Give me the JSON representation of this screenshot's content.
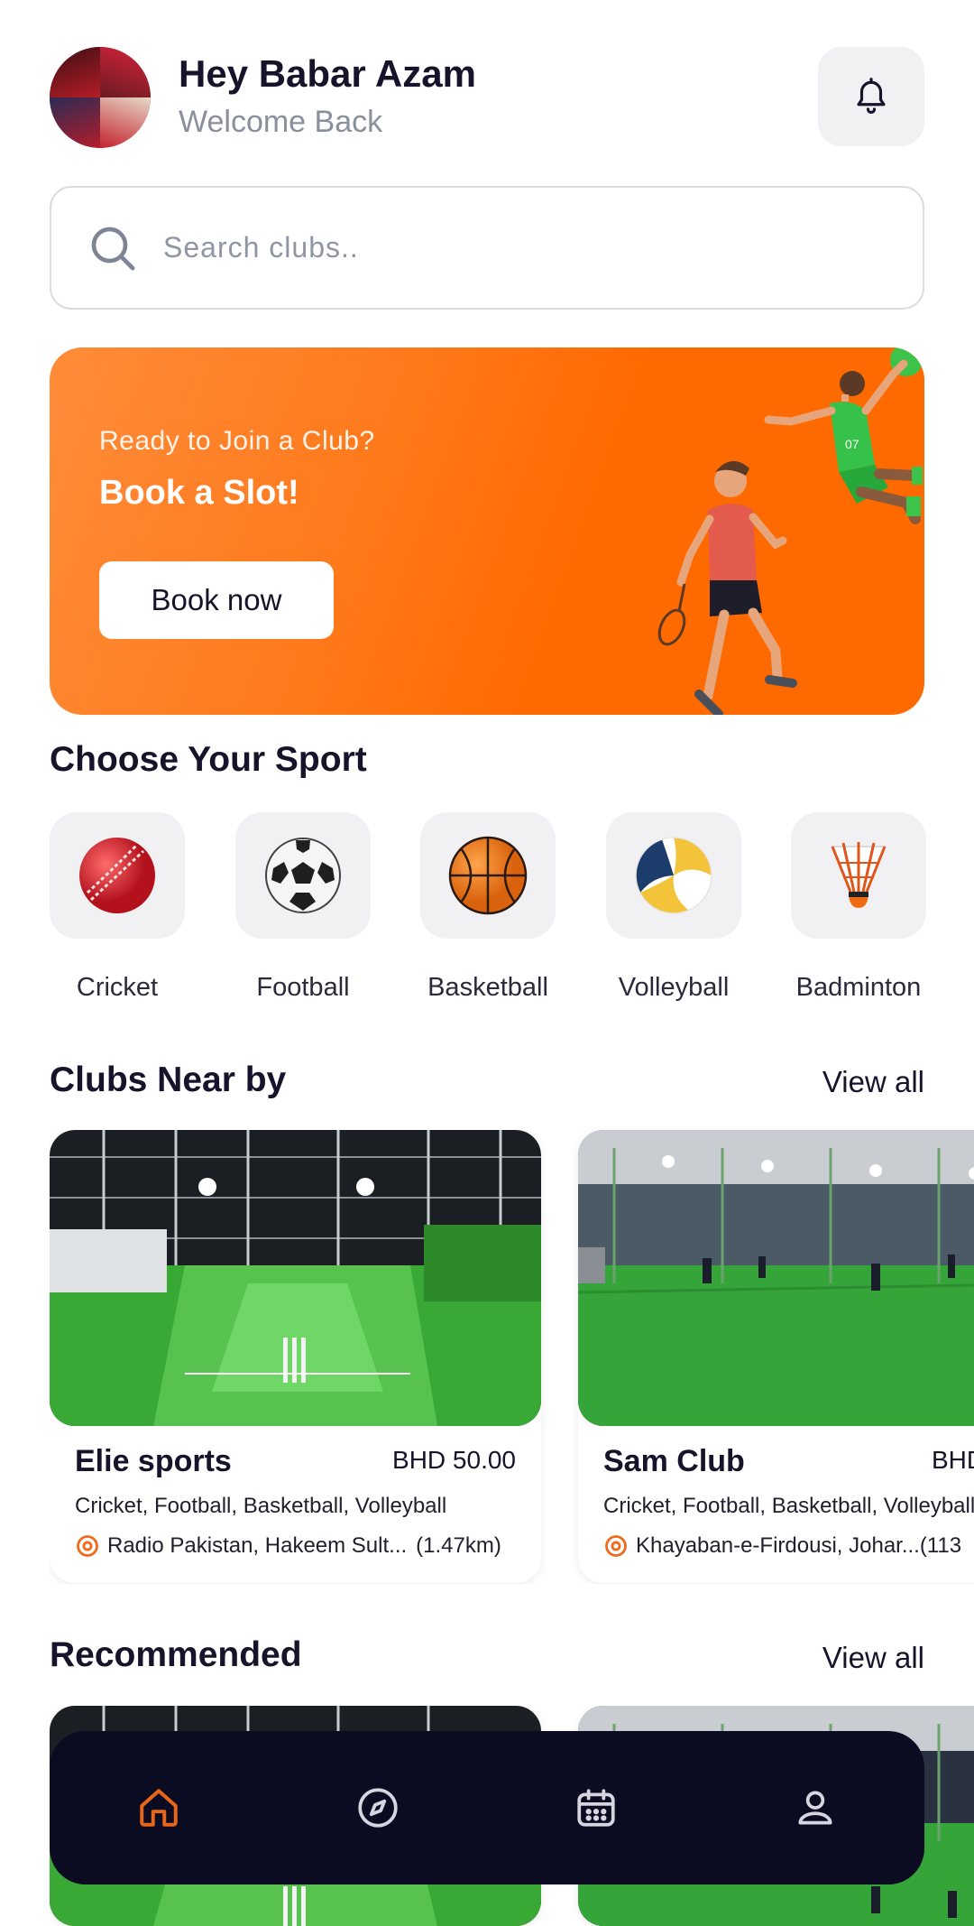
{
  "header": {
    "greeting": "Hey Babar Azam",
    "subtitle": "Welcome Back",
    "avatar_icon": "avatar-photo",
    "bell_icon": "bell-icon"
  },
  "search": {
    "placeholder": "Search clubs..",
    "icon": "search-icon"
  },
  "banner": {
    "pretitle": "Ready to Join a Club?",
    "title": "Book a Slot!",
    "button_label": "Book now",
    "colors": {
      "start": "#ff8c3a",
      "end": "#ff6a00"
    }
  },
  "sports_section": {
    "title": "Choose Your Sport",
    "items": [
      {
        "label": "Cricket",
        "icon": "cricket-ball-icon"
      },
      {
        "label": "Football",
        "icon": "football-icon"
      },
      {
        "label": "Basketball",
        "icon": "basketball-icon"
      },
      {
        "label": "Volleyball",
        "icon": "volleyball-icon"
      },
      {
        "label": "Badminton",
        "icon": "shuttlecock-icon"
      }
    ]
  },
  "clubs_section": {
    "title": "Clubs Near by",
    "view_all": "View all",
    "items": [
      {
        "name": "Elie sports",
        "price": "BHD 50.00",
        "sports": "Cricket, Football, Basketball, Volleyball",
        "location": "Radio Pakistan, Hakeem Sult...",
        "distance": "(1.47km)"
      },
      {
        "name": "Sam Club",
        "price": "BHD",
        "sports": "Cricket, Football, Basketball, Volleyball",
        "location": "Khayaban-e-Firdousi, Johar...",
        "distance": "(113"
      }
    ]
  },
  "recommended_section": {
    "title": "Recommended",
    "view_all": "View all"
  },
  "navbar": {
    "items": [
      {
        "icon": "home-icon",
        "active": true
      },
      {
        "icon": "compass-icon",
        "active": false
      },
      {
        "icon": "calendar-icon",
        "active": false
      },
      {
        "icon": "profile-icon",
        "active": false
      }
    ],
    "active_color": "#e8661a",
    "inactive_color": "#d6d6e0"
  },
  "theme": {
    "accent": "#ff6a00",
    "dark": "#0b0b22"
  }
}
